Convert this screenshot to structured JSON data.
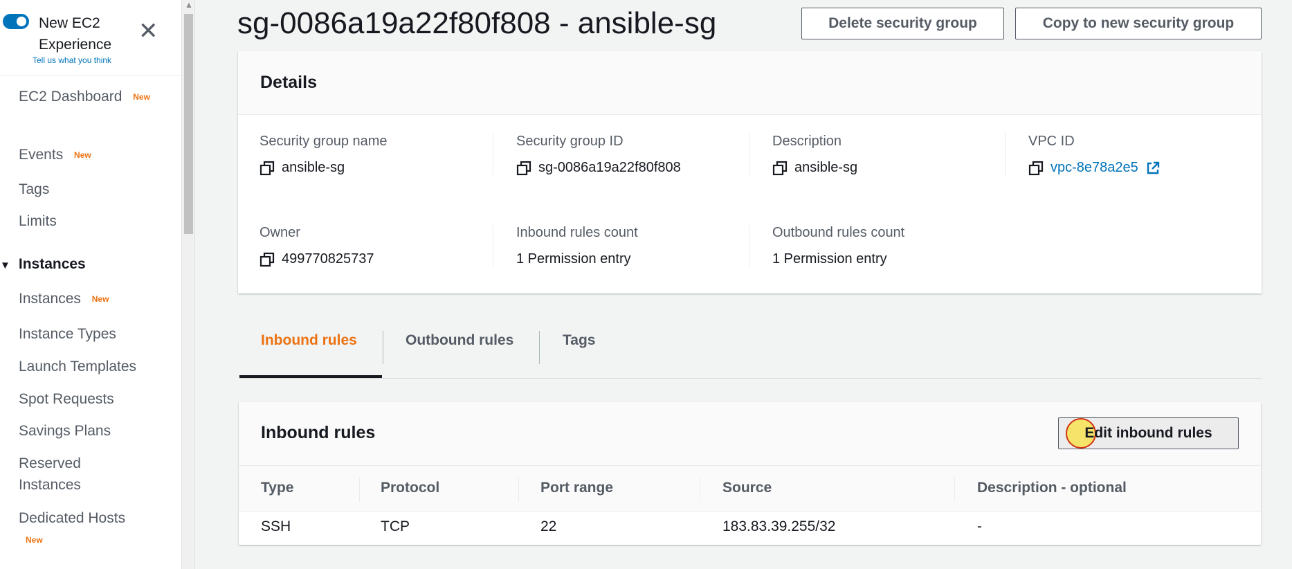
{
  "sidebar": {
    "toggle_title": "New EC2 Experience",
    "toggle_subtitle": "Tell us what you think",
    "new_badge": "New",
    "items": [
      {
        "label": "EC2 Dashboard",
        "badge": "New"
      },
      {
        "label": "Events",
        "badge": "New"
      },
      {
        "label": "Tags",
        "badge": ""
      },
      {
        "label": "Limits",
        "badge": ""
      }
    ],
    "section": "Instances",
    "section_items": [
      {
        "label": "Instances",
        "badge": "New"
      },
      {
        "label": "Instance Types",
        "badge": ""
      },
      {
        "label": "Launch Templates",
        "badge": ""
      },
      {
        "label": "Spot Requests",
        "badge": ""
      },
      {
        "label": "Savings Plans",
        "badge": ""
      },
      {
        "label": "Reserved Instances",
        "badge": ""
      },
      {
        "label": "Dedicated Hosts",
        "badge": "New"
      }
    ]
  },
  "header": {
    "title": "sg-0086a19a22f80f808 - ansible-sg",
    "delete_button": "Delete security group",
    "copy_button": "Copy to new security group"
  },
  "details": {
    "title": "Details",
    "fields": [
      {
        "label": "Security group name",
        "value": "ansible-sg",
        "copyable": true
      },
      {
        "label": "Security group ID",
        "value": "sg-0086a19a22f80f808",
        "copyable": true
      },
      {
        "label": "Description",
        "value": "ansible-sg",
        "copyable": true
      },
      {
        "label": "VPC ID",
        "value": "vpc-8e78a2e5",
        "copyable": true,
        "link": true
      },
      {
        "label": "Owner",
        "value": "499770825737",
        "copyable": true
      },
      {
        "label": "Inbound rules count",
        "value": "1 Permission entry",
        "copyable": false
      },
      {
        "label": "Outbound rules count",
        "value": "1 Permission entry",
        "copyable": false
      }
    ]
  },
  "tabs": [
    {
      "label": "Inbound rules",
      "active": true
    },
    {
      "label": "Outbound rules",
      "active": false
    },
    {
      "label": "Tags",
      "active": false
    }
  ],
  "inbound": {
    "title": "Inbound rules",
    "edit_button": "Edit inbound rules",
    "columns": [
      "Type",
      "Protocol",
      "Port range",
      "Source",
      "Description - optional"
    ],
    "rows": [
      [
        "SSH",
        "TCP",
        "22",
        "183.83.39.255/32",
        "-"
      ]
    ]
  },
  "colors": {
    "accent": "#ec7211",
    "link": "#0073bb",
    "toggle": "#0073bb"
  },
  "icons": [
    "close-icon",
    "copy-icon",
    "external-link-icon",
    "caret-down-icon"
  ]
}
